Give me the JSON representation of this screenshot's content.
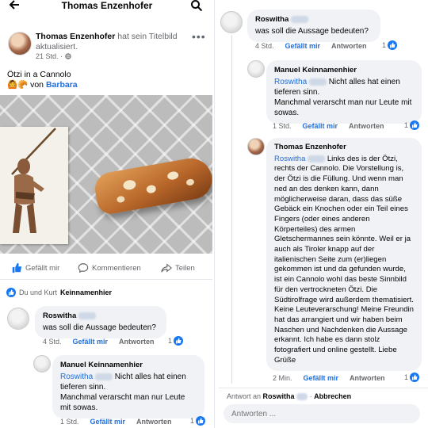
{
  "left": {
    "header": {
      "back_icon": "arrow-left-icon",
      "title": "Thomas Enzenhofer",
      "search_icon": "search-icon"
    },
    "post": {
      "author": "Thomas Enzenhofer",
      "action": "hat sein Titelbild aktualisiert.",
      "time": "21 Std.",
      "audience_icon": "globe-icon",
      "text_line1": "Ötzi in a Cannolo",
      "emoji": "🙆🥐",
      "text_by": "von",
      "mention": "Barbara"
    },
    "actions": {
      "like": "Gefällt mir",
      "comment": "Kommentieren",
      "share": "Teilen"
    },
    "likes": {
      "prefix": "Du und Kurt",
      "name": "Keinnamenhier"
    },
    "comment1": {
      "name": "Roswitha",
      "text": "was soll die Aussage bedeuten?",
      "time": "4 Std.",
      "like": "Gefällt mir",
      "reply": "Antworten",
      "count": "1"
    },
    "comment2": {
      "name": "Manuel Keinnamenhier",
      "mention": "Roswitha",
      "text": "Nicht alles hat einen tieferen sinn.",
      "text2": "Manchmal verarscht man nur Leute mit sowas.",
      "time": "1 Std.",
      "like": "Gefällt mir",
      "reply": "Antworten",
      "count": "1"
    }
  },
  "right": {
    "comment1": {
      "name": "Roswitha",
      "text": "was soll die Aussage bedeuten?",
      "time": "4 Std.",
      "like": "Gefällt mir",
      "reply": "Antworten",
      "count": "1"
    },
    "comment2": {
      "name": "Manuel Keinnamenhier",
      "mention": "Roswitha",
      "text": "Nicht alles hat einen tieferen sinn.",
      "text2": "Manchmal verarscht man nur Leute mit sowas.",
      "time": "1 Std.",
      "like": "Gefällt mir",
      "reply": "Antworten",
      "count": "1"
    },
    "comment3": {
      "name": "Thomas Enzenhofer",
      "mention": "Roswitha",
      "text": "Links des is der Ötzi, rechts der Cannolo. Die Vorstellung is, der Ötzi is die Füllung. Und wenn man ned an des denken kann, dann möglicherweise daran, dass das süße Gebäck ein Knochen oder ein Teil eines Fingers (oder eines anderen Körperteiles) des armen Gletschermannes sein könnte. Weil er ja auch als Tiroler knapp auf der italienischen Seite zum (er)liegen gekommen ist und da gefunden wurde, ist ein Cannolo wohl das beste Sinnbild für den vertrockneten Ötzi. Die Südtirolfrage wird außerdem thematisiert. Keine Leuteverarschung! Meine Freundin hat das arrangiert und wir haben beim Naschen und Nachdenken die Aussage erkannt. Ich habe es dann stolz fotografiert und online gestellt. Liebe Grüße",
      "time": "2 Min.",
      "like": "Gefällt mir",
      "reply": "Antworten",
      "count": "1"
    },
    "reply_bar": {
      "prefix": "Antwort an",
      "name": "Roswitha",
      "separator": "·",
      "cancel": "Abbrechen",
      "placeholder": "Antworten ..."
    }
  },
  "colors": {
    "accent": "#1877f2",
    "link": "#216fdb",
    "bubble": "#f0f2f5",
    "muted": "#65676b"
  }
}
